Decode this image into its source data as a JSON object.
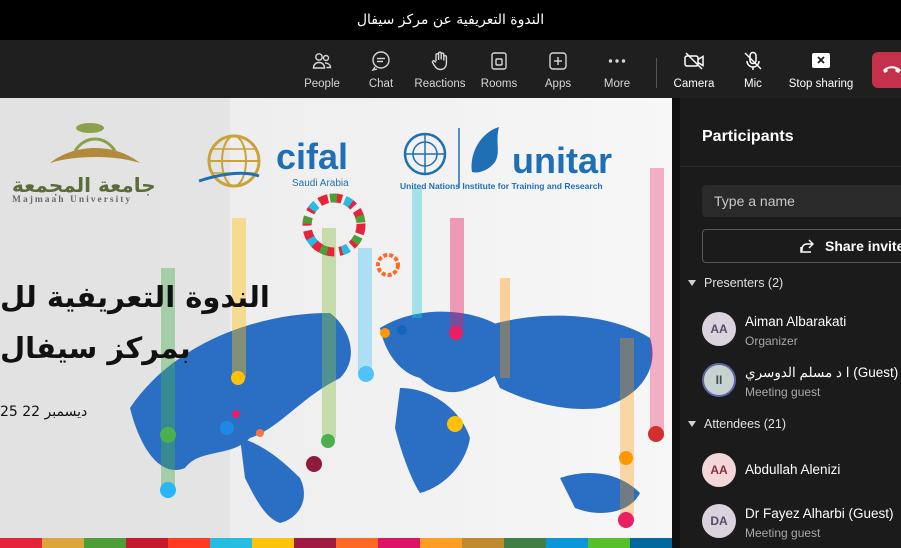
{
  "window": {
    "title": "الندوة التعريفية عن مركز سيفال"
  },
  "toolbar": {
    "people": "People",
    "chat": "Chat",
    "reactions": "Reactions",
    "rooms": "Rooms",
    "apps": "Apps",
    "more": "More",
    "camera": "Camera",
    "mic": "Mic",
    "stop_sharing": "Stop sharing"
  },
  "slide": {
    "university_ar": "جامعة المجمعة",
    "university_en": "Majmaah University",
    "cifal": "cifal",
    "cifal_sub": "Saudi Arabia",
    "unitar": "unitar",
    "unitar_sub": "United Nations Institute for Training and Research",
    "heading_line1": "الندوة التعريفية لل",
    "heading_line2": "بمركز سيفال",
    "date": "25 ديسمبر 22"
  },
  "panel": {
    "title": "Participants",
    "search_placeholder": "Type a name",
    "share_invite": "Share invite",
    "presenters_label": "Presenters (2)",
    "attendees_label": "Attendees (21)",
    "presenters": [
      {
        "initials": "AA",
        "name": "Aiman Albarakati",
        "role": "Organizer"
      },
      {
        "initials": "II",
        "name": "ا د مسلم الدوسري (Guest)",
        "role": "Meeting guest"
      }
    ],
    "attendees": [
      {
        "initials": "AA",
        "name": "Abdullah Alenizi",
        "role": ""
      },
      {
        "initials": "DA",
        "name": "Dr Fayez Alharbi (Guest)",
        "role": "Meeting guest"
      }
    ]
  },
  "colors": {
    "leave_red": "#c4314b",
    "accent": "#6264a7",
    "unitar_blue": "#1f6fb5",
    "map_blue": "#2a6fc4"
  }
}
